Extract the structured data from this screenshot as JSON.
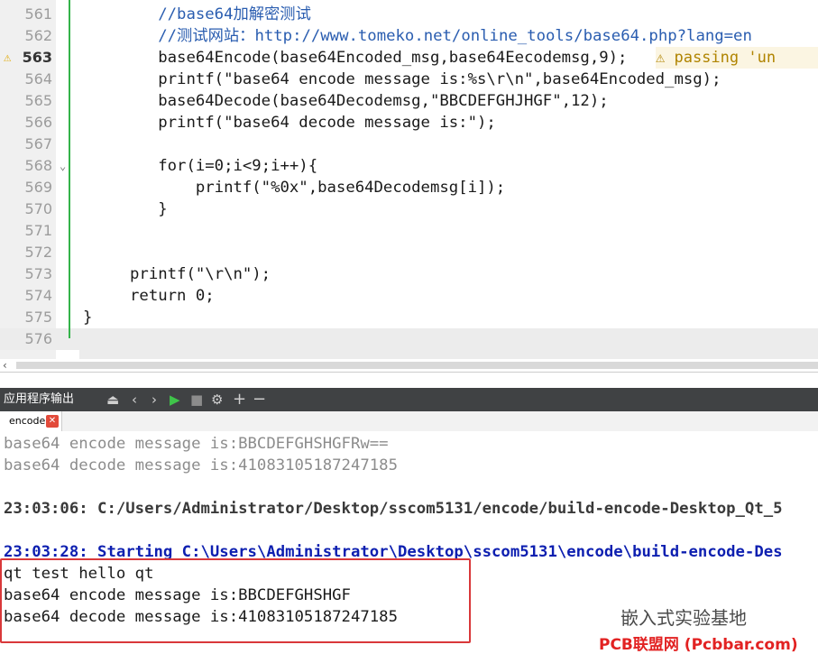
{
  "editor": {
    "lines": [
      {
        "num": "561",
        "text": "        //base64加解密测试",
        "kind": "comment"
      },
      {
        "num": "562",
        "text": "        //测试网站：http://www.tomeko.net/online_tools/base64.php?lang=en",
        "kind": "comment"
      },
      {
        "num": "563",
        "text": "        base64Encode(base64Encoded_msg,base64Eecodemsg,9);",
        "kind": "code"
      },
      {
        "num": "564",
        "text": "        printf(\"base64 encode message is:%s\\r\\n\",base64Encoded_msg);",
        "kind": "code"
      },
      {
        "num": "565",
        "text": "        base64Decode(base64Decodemsg,\"BBCDEFGHJHGF\",12);",
        "kind": "code"
      },
      {
        "num": "566",
        "text": "        printf(\"base64 decode message is:\");",
        "kind": "code"
      },
      {
        "num": "567",
        "text": "",
        "kind": "code"
      },
      {
        "num": "568",
        "text": "        for(i=0;i<9;i++){",
        "kind": "code"
      },
      {
        "num": "569",
        "text": "            printf(\"%0x\",base64Decodemsg[i]);",
        "kind": "code"
      },
      {
        "num": "570",
        "text": "        }",
        "kind": "code"
      },
      {
        "num": "571",
        "text": "",
        "kind": "code"
      },
      {
        "num": "572",
        "text": "",
        "kind": "code"
      },
      {
        "num": "573",
        "text": "     printf(\"\\r\\n\");",
        "kind": "code"
      },
      {
        "num": "574",
        "text": "     return 0;",
        "kind": "code"
      },
      {
        "num": "575",
        "text": "}",
        "kind": "code"
      },
      {
        "num": "576",
        "text": "",
        "kind": "code"
      }
    ],
    "warning_line": "563",
    "warning_text": "⚠ passing 'un",
    "fold_marker": "⌄"
  },
  "panel": {
    "title": "应用程序输出",
    "buttons": [
      "⏏",
      "‹",
      "›",
      "▶",
      "■",
      "⚙",
      "+",
      "−"
    ]
  },
  "tab": {
    "label": "encode",
    "close": "✕"
  },
  "output": [
    {
      "text": "base64 encode message is:BBCDEFGHSHGFRw==",
      "style": "grey"
    },
    {
      "text": "base64 decode message is:41083105187247185",
      "style": "grey"
    },
    {
      "text": "",
      "style": "grey"
    },
    {
      "text": "23:03:06: C:/Users/Administrator/Desktop/sscom5131/encode/build-encode-Desktop_Qt_5",
      "style": "ts"
    },
    {
      "text": "",
      "style": "grey"
    },
    {
      "text": "23:03:28: Starting C:\\Users\\Administrator\\Desktop\\sscom5131\\encode\\build-encode-Des",
      "style": "blue"
    },
    {
      "text": "qt test hello qt",
      "style": "dark"
    },
    {
      "text": "base64 encode message is:BBCDEFGHSHGF",
      "style": "dark"
    },
    {
      "text": "base64 decode message is:41083105187247185",
      "style": "dark"
    }
  ],
  "watermark": {
    "line1": "嵌入式实验基地",
    "line2": "PCB联盟网 (Pcbbar.com)"
  }
}
